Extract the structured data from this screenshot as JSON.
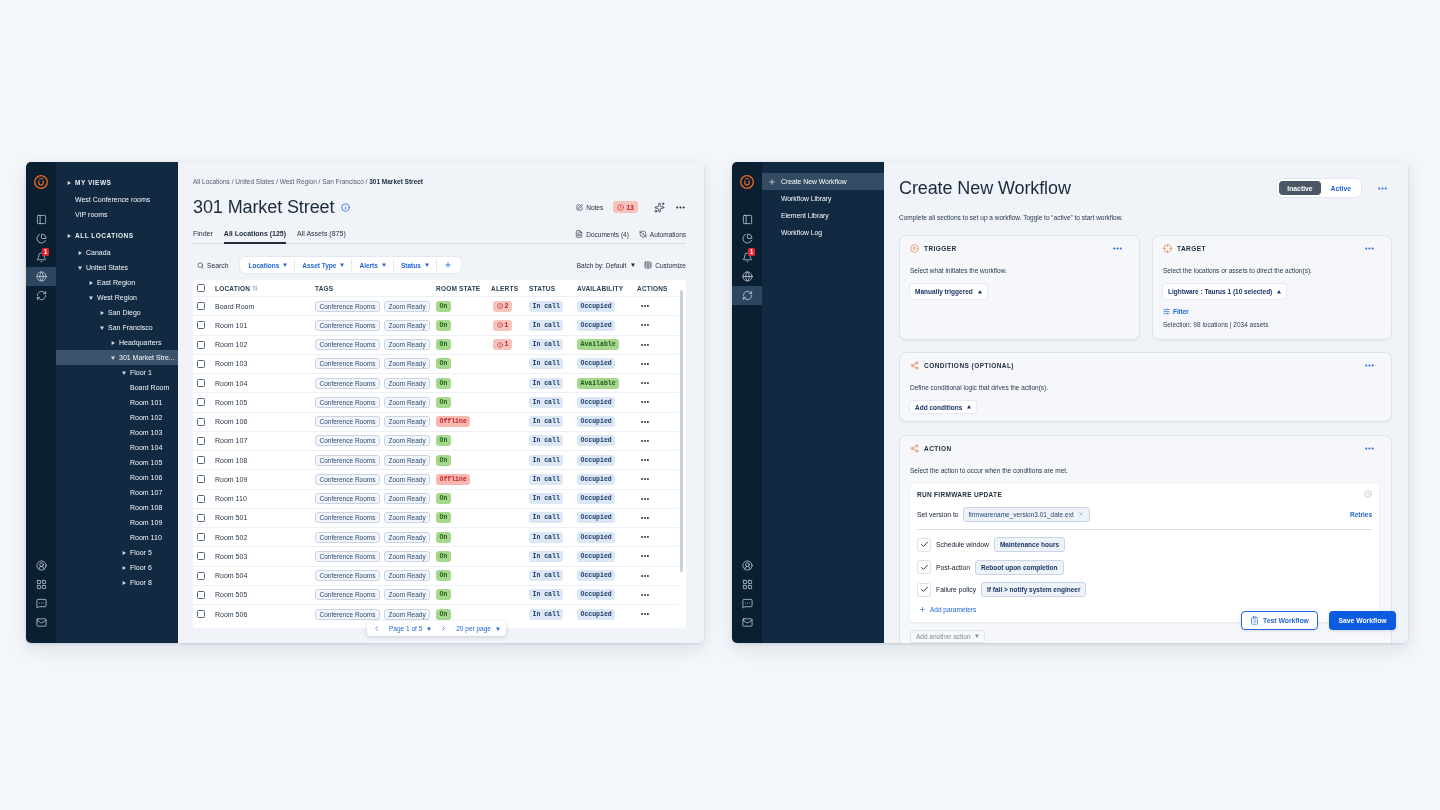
{
  "locations_window": {
    "rail": {
      "top": [
        {
          "selected": false
        },
        {
          "selected": false
        },
        {
          "selected": false,
          "badge": "1"
        },
        {
          "selected": true
        },
        {
          "selected": false
        }
      ],
      "bottom": [
        {
          "selected": false
        },
        {
          "selected": false
        },
        {
          "selected": false
        },
        {
          "selected": false
        }
      ]
    },
    "tree": {
      "sections": [
        {
          "title": "MY VIEWS",
          "items": [
            {
              "label": "West Conference rooms",
              "selected": false
            },
            {
              "label": "VIP rooms",
              "selected": false
            }
          ]
        },
        {
          "title": "ALL LOCATIONS",
          "items": [
            {
              "label": "Canada",
              "expanded": false,
              "selected": false
            },
            {
              "label": "United States",
              "expanded": true,
              "selected": false,
              "children": [
                {
                  "label": "East Region",
                  "expanded": false,
                  "selected": false
                },
                {
                  "label": "West Region",
                  "expanded": true,
                  "selected": false,
                  "children": [
                    {
                      "label": "San Diego",
                      "expanded": false,
                      "selected": false
                    },
                    {
                      "label": "San Francisco",
                      "expanded": true,
                      "selected": false,
                      "children": [
                        {
                          "label": "Headquarters",
                          "expanded": false,
                          "selected": false
                        },
                        {
                          "label": "301 Market Stre...",
                          "expanded": true,
                          "selected": true,
                          "children": [
                            {
                              "label": "Floor 1",
                              "expanded": true,
                              "selected": false,
                              "children": [
                                {
                                  "label": "Board Room",
                                  "selected": false
                                },
                                {
                                  "label": "Room 101",
                                  "selected": false
                                },
                                {
                                  "label": "Room 102",
                                  "selected": false
                                },
                                {
                                  "label": "Room 103",
                                  "selected": false
                                },
                                {
                                  "label": "Room 104",
                                  "selected": false
                                },
                                {
                                  "label": "Room 105",
                                  "selected": false
                                },
                                {
                                  "label": "Room 106",
                                  "selected": false
                                },
                                {
                                  "label": "Room 107",
                                  "selected": false
                                },
                                {
                                  "label": "Room 108",
                                  "selected": false
                                },
                                {
                                  "label": "Room 109",
                                  "selected": false
                                },
                                {
                                  "label": "Room 110",
                                  "selected": false
                                }
                              ]
                            },
                            {
                              "label": "Floor 5",
                              "expanded": false,
                              "selected": false
                            },
                            {
                              "label": "Floor 6",
                              "expanded": false,
                              "selected": false
                            },
                            {
                              "label": "Floor 8",
                              "expanded": false,
                              "selected": false
                            }
                          ]
                        }
                      ]
                    }
                  ]
                }
              ]
            }
          ]
        }
      ]
    },
    "breadcrumb": "All Locations / United States / West Region / San Francisco / **301 Market Street**",
    "title": "301 Market Street",
    "header_actions": {
      "notes": "Notes",
      "alert_count": "13"
    },
    "tabs": [
      {
        "label": "Finder",
        "selected": false
      },
      {
        "label": "All Locations (125)",
        "selected": true
      },
      {
        "label": "All Assets (875)",
        "selected": false
      }
    ],
    "links": {
      "documents": "Documents (4)",
      "automations": "Automations"
    },
    "toolbar": {
      "search": "Search",
      "filters": [
        "Locations",
        "Asset Type",
        "Alerts",
        "Status"
      ],
      "batch": "Batch by: Default",
      "customize": "Customize"
    },
    "table": {
      "header_checked": false,
      "columns": [
        "LOCATION",
        "TAGS",
        "ROOM STATE",
        "ALERTS",
        "STATUS",
        "AVAILABILITY",
        "ACTIONS"
      ],
      "rows": [
        {
          "checked": false,
          "location": "Board Room",
          "tags": [
            "Conference Rooms",
            "Zoom Ready"
          ],
          "room_state": {
            "label": "On",
            "kind": "on"
          },
          "alert": "2",
          "status": "In call",
          "availability": {
            "label": "Occupied",
            "kind": "occupied"
          }
        },
        {
          "checked": false,
          "location": "Room 101",
          "tags": [
            "Conference Rooms",
            "Zoom Ready"
          ],
          "room_state": {
            "label": "On",
            "kind": "on"
          },
          "alert": "1",
          "status": "In call",
          "availability": {
            "label": "Occupied",
            "kind": "occupied"
          }
        },
        {
          "checked": false,
          "location": "Room 102",
          "tags": [
            "Conference Rooms",
            "Zoom Ready"
          ],
          "room_state": {
            "label": "On",
            "kind": "on"
          },
          "alert": "1",
          "status": "In call",
          "availability": {
            "label": "Available",
            "kind": "available"
          }
        },
        {
          "checked": false,
          "location": "Room 103",
          "tags": [
            "Conference Rooms",
            "Zoom Ready"
          ],
          "room_state": {
            "label": "On",
            "kind": "on"
          },
          "status": "In call",
          "availability": {
            "label": "Occupied",
            "kind": "occupied"
          }
        },
        {
          "checked": false,
          "location": "Room 104",
          "tags": [
            "Conference Rooms",
            "Zoom Ready"
          ],
          "room_state": {
            "label": "On",
            "kind": "on"
          },
          "status": "In call",
          "availability": {
            "label": "Available",
            "kind": "available"
          }
        },
        {
          "checked": false,
          "location": "Room 105",
          "tags": [
            "Conference Rooms",
            "Zoom Ready"
          ],
          "room_state": {
            "label": "On",
            "kind": "on"
          },
          "status": "In call",
          "availability": {
            "label": "Occupied",
            "kind": "occupied"
          }
        },
        {
          "checked": false,
          "location": "Room 106",
          "tags": [
            "Conference Rooms",
            "Zoom Ready"
          ],
          "room_state": {
            "label": "Offline",
            "kind": "offline"
          },
          "status": "In call",
          "availability": {
            "label": "Occupied",
            "kind": "occupied"
          }
        },
        {
          "checked": false,
          "location": "Room 107",
          "tags": [
            "Conference Rooms",
            "Zoom Ready"
          ],
          "room_state": {
            "label": "On",
            "kind": "on"
          },
          "status": "In call",
          "availability": {
            "label": "Occupied",
            "kind": "occupied"
          }
        },
        {
          "checked": false,
          "location": "Room 108",
          "tags": [
            "Conference Rooms",
            "Zoom Ready"
          ],
          "room_state": {
            "label": "On",
            "kind": "on"
          },
          "status": "In call",
          "availability": {
            "label": "Occupied",
            "kind": "occupied"
          }
        },
        {
          "checked": false,
          "location": "Room 109",
          "tags": [
            "Conference Rooms",
            "Zoom Ready"
          ],
          "room_state": {
            "label": "Offline",
            "kind": "offline"
          },
          "status": "In call",
          "availability": {
            "label": "Occupied",
            "kind": "occupied"
          }
        },
        {
          "checked": false,
          "location": "Room 110",
          "tags": [
            "Conference Rooms",
            "Zoom Ready"
          ],
          "room_state": {
            "label": "On",
            "kind": "on"
          },
          "status": "In call",
          "availability": {
            "label": "Occupied",
            "kind": "occupied"
          }
        },
        {
          "checked": false,
          "location": "Room 501",
          "tags": [
            "Conference Rooms",
            "Zoom Ready"
          ],
          "room_state": {
            "label": "On",
            "kind": "on"
          },
          "status": "In call",
          "availability": {
            "label": "Occupied",
            "kind": "occupied"
          }
        },
        {
          "checked": false,
          "location": "Room 502",
          "tags": [
            "Conference Rooms",
            "Zoom Ready"
          ],
          "room_state": {
            "label": "On",
            "kind": "on"
          },
          "status": "In call",
          "availability": {
            "label": "Occupied",
            "kind": "occupied"
          }
        },
        {
          "checked": false,
          "location": "Room 503",
          "tags": [
            "Conference Rooms",
            "Zoom Ready"
          ],
          "room_state": {
            "label": "On",
            "kind": "on"
          },
          "status": "In call",
          "availability": {
            "label": "Occupied",
            "kind": "occupied"
          }
        },
        {
          "checked": false,
          "location": "Room 504",
          "tags": [
            "Conference Rooms",
            "Zoom Ready"
          ],
          "room_state": {
            "label": "On",
            "kind": "on"
          },
          "status": "In call",
          "availability": {
            "label": "Occupied",
            "kind": "occupied"
          }
        },
        {
          "checked": false,
          "location": "Room 505",
          "tags": [
            "Conference Rooms",
            "Zoom Ready"
          ],
          "room_state": {
            "label": "On",
            "kind": "on"
          },
          "status": "In call",
          "availability": {
            "label": "Occupied",
            "kind": "occupied"
          }
        },
        {
          "checked": false,
          "location": "Room 506",
          "tags": [
            "Conference Rooms",
            "Zoom Ready"
          ],
          "room_state": {
            "label": "On",
            "kind": "on"
          },
          "status": "In call",
          "availability": {
            "label": "Occupied",
            "kind": "occupied"
          }
        }
      ]
    },
    "pagination": {
      "page": "Page 1 of 5",
      "per_page": "20 per page"
    }
  },
  "workflow_window": {
    "rail": {
      "top": [
        {
          "selected": false
        },
        {
          "selected": false
        },
        {
          "selected": false,
          "badge": "1"
        },
        {
          "selected": false
        },
        {
          "selected": true
        }
      ],
      "bottom": [
        {
          "selected": false
        },
        {
          "selected": false
        },
        {
          "selected": false
        },
        {
          "selected": false
        }
      ]
    },
    "nav": [
      {
        "label": "Create New Workflow",
        "kind": "create",
        "selected": true
      },
      {
        "label": "Workflow Library",
        "kind": "page",
        "selected": false
      },
      {
        "label": "Element Library",
        "kind": "page",
        "selected": false
      },
      {
        "label": "Workflow Log",
        "kind": "page",
        "selected": false
      }
    ],
    "title": "Create New Workflow",
    "toggle": [
      {
        "label": "Inactive",
        "selected": true
      },
      {
        "label": "Active",
        "selected": false
      }
    ],
    "subtitle": "Complete all sections to set up a workflow. Toggle to “active” to start workflow.",
    "trigger": {
      "title": "TRIGGER",
      "description": "Select what initiates the workflow.",
      "dropdown": "Manually triggered"
    },
    "target": {
      "title": "TARGET",
      "description": "Select the locations or assets to direct the action(s).",
      "dropdown": "Lightware : Taurus 1 (10 selected)",
      "filter": "Filter",
      "selection": "Selection: 98 locations | 2034 assets"
    },
    "conditions": {
      "title": "CONDITIONS (OPTIONAL)",
      "description": "Define conditional logic that drives the action(s).",
      "dropdown": "Add conditions"
    },
    "action": {
      "title": "ACTION",
      "description": "Select the action to occur when the conditions are met.",
      "step": {
        "title": "RUN FIRMWARE UPDATE",
        "version_label": "Set version to",
        "version_file": "firmwarename_version3.01_date.ext",
        "retries": "Retries",
        "parameters": [
          {
            "label": "Schedule window",
            "value": "Maintenance hours",
            "checked": true
          },
          {
            "label": "Post-action",
            "value": "Reboot upon completion",
            "checked": true
          },
          {
            "label": "Failure policy",
            "value": "If fail > notify system engineer",
            "checked": true
          }
        ],
        "add_parameters": "Add parameters"
      },
      "add_another": "Add another action"
    },
    "buttons": {
      "test": "Test Workflow",
      "save": "Save Workflow"
    }
  }
}
